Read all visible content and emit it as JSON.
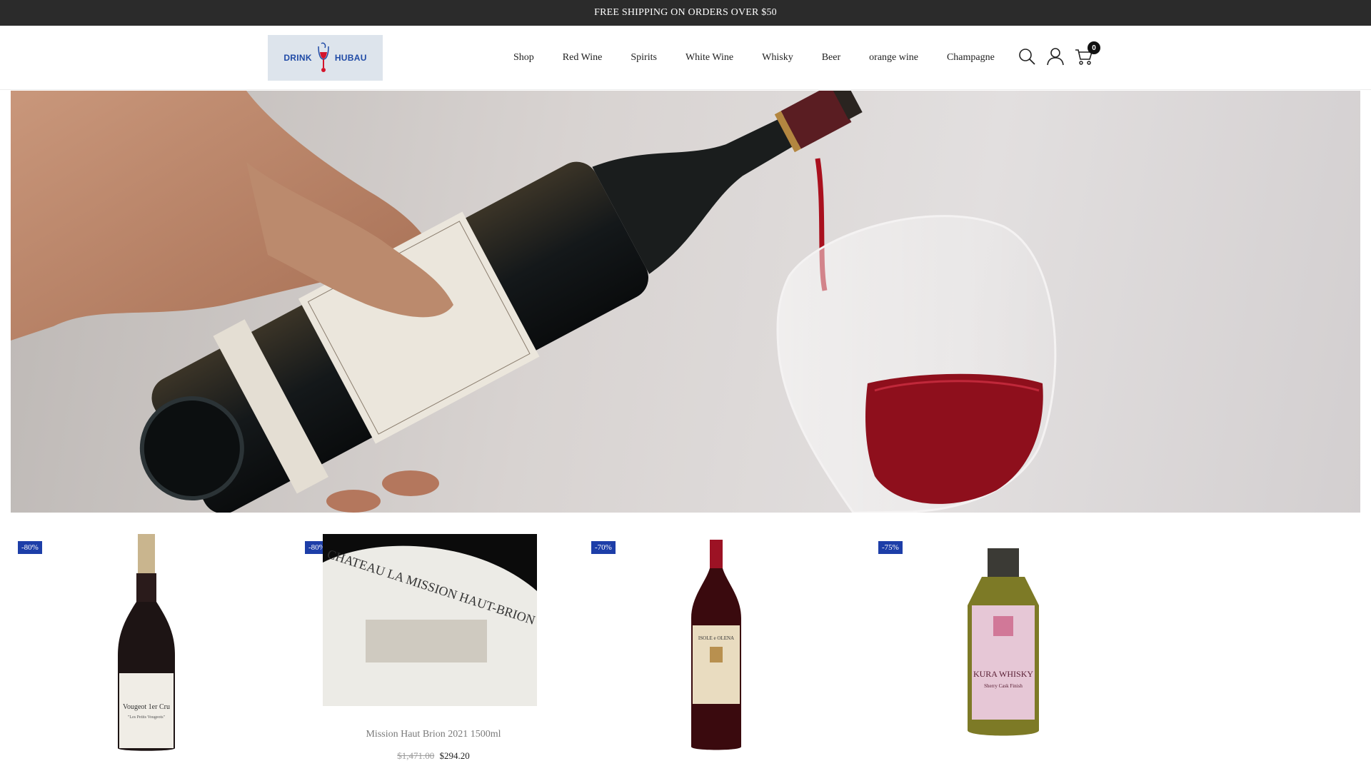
{
  "announcement": "FREE SHIPPING ON ORDERS OVER $50",
  "logo": {
    "left_word": "DRINK",
    "right_word": "HUBAU"
  },
  "nav": {
    "items": [
      "Shop",
      "Red Wine",
      "Spirits",
      "White Wine",
      "Whisky",
      "Beer",
      "orange wine",
      "Champagne"
    ]
  },
  "header_icons": {
    "search": "search-icon",
    "account": "user-icon",
    "cart": "cart-icon",
    "cart_count": "0"
  },
  "colors": {
    "announcement_bg": "#2b2b2b",
    "badge_bg": "#1d3ea8",
    "wine_red": "#8e0f1c"
  },
  "products": [
    {
      "badge": "-80%",
      "label_text": "Vougeot 1er Cru",
      "label_sub": "\"Les Petits Vougeots\""
    },
    {
      "badge": "-80%",
      "name": "Mission Haut Brion 2021 1500ml",
      "old_price": "$1,471.00",
      "price": "$294.20",
      "label_text": "CHATEAU LA MISSION HAUT-BRION"
    },
    {
      "badge": "-70%",
      "label_text": "ISOLE e OLENA"
    },
    {
      "badge": "-75%",
      "label_text": "KURA WHISKY",
      "label_sub": "Sherry Cask Finish"
    }
  ]
}
